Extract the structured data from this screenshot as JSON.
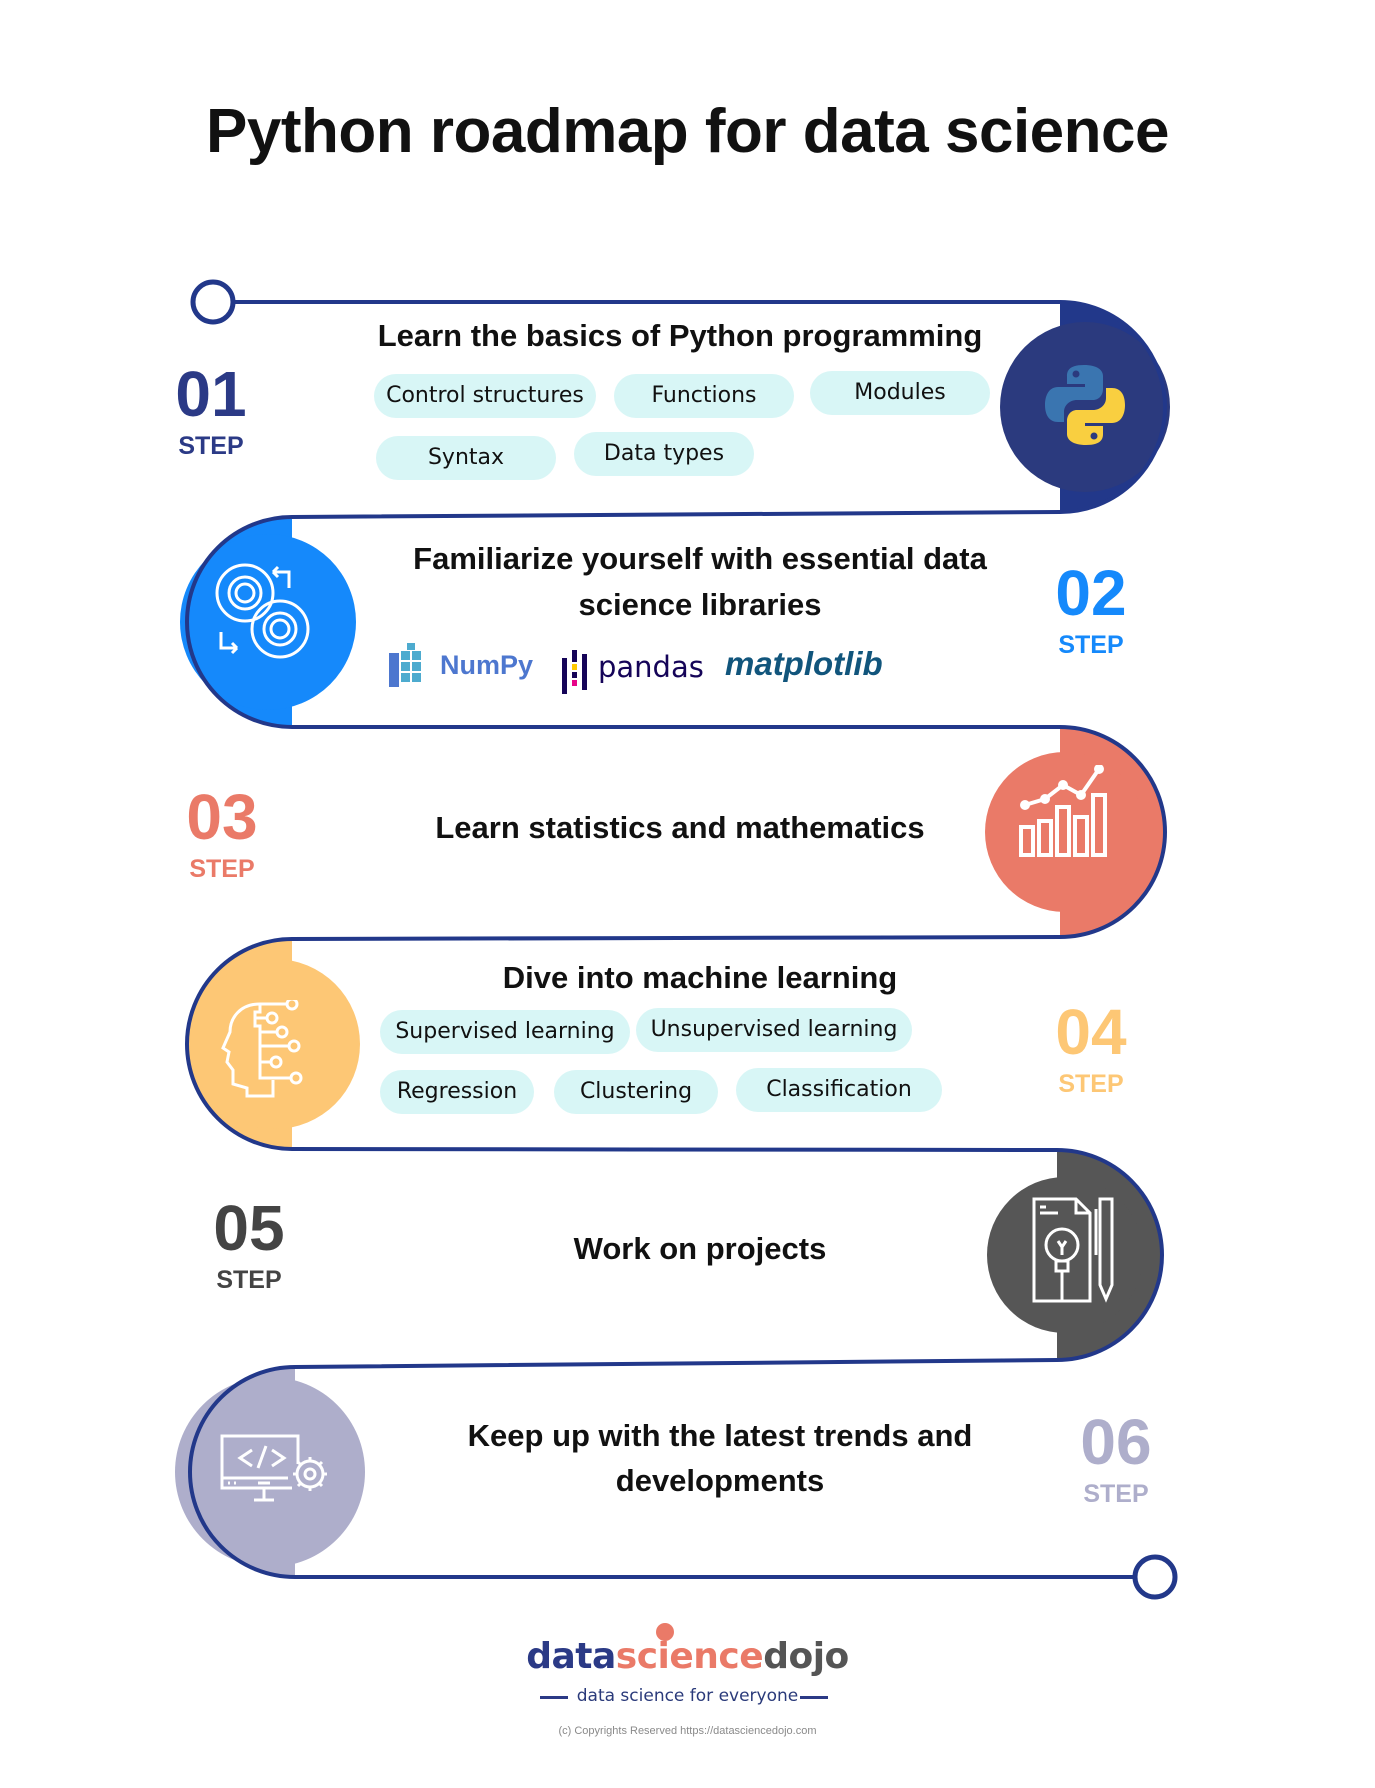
{
  "title": "Python roadmap for data science",
  "colors": {
    "road": "#22388a",
    "pill_bg": "#d8f6f6",
    "step1": "#2b3a86",
    "step2": "#1589fb",
    "step3": "#ea7a68",
    "step4": "#fdc775",
    "step5": "#565656",
    "step6": "#aeaecb"
  },
  "steps": [
    {
      "number": "01",
      "label": "STEP",
      "heading": "Learn the basics of Python programming",
      "icon": "python-logo-icon",
      "pills": [
        "Control structures",
        "Functions",
        "Modules",
        "Syntax",
        "Data types"
      ]
    },
    {
      "number": "02",
      "label": "STEP",
      "heading_line1": "Familiarize yourself with essential data",
      "heading_line2": "science libraries",
      "icon": "gears-icon",
      "libraries": [
        "NumPy",
        "pandas",
        "matplotlib"
      ]
    },
    {
      "number": "03",
      "label": "STEP",
      "heading": "Learn statistics and mathematics",
      "icon": "bar-chart-trend-icon"
    },
    {
      "number": "04",
      "label": "STEP",
      "heading": "Dive into machine learning",
      "icon": "ai-head-icon",
      "pills": [
        "Supervised learning",
        "Unsupervised learning",
        "Regression",
        "Clustering",
        "Classification"
      ]
    },
    {
      "number": "05",
      "label": "STEP",
      "heading": "Work on projects",
      "icon": "lightbulb-document-pencil-icon"
    },
    {
      "number": "06",
      "label": "STEP",
      "heading_line1": "Keep up with the latest trends and",
      "heading_line2": "developments",
      "icon": "monitor-code-gear-icon"
    }
  ],
  "footer": {
    "brand_part1": "data",
    "brand_part2": "science",
    "brand_part3": "dojo",
    "tagline": "data science for everyone",
    "copyright": "(c) Copyrights Reserved  https://datasciencedojo.com"
  }
}
